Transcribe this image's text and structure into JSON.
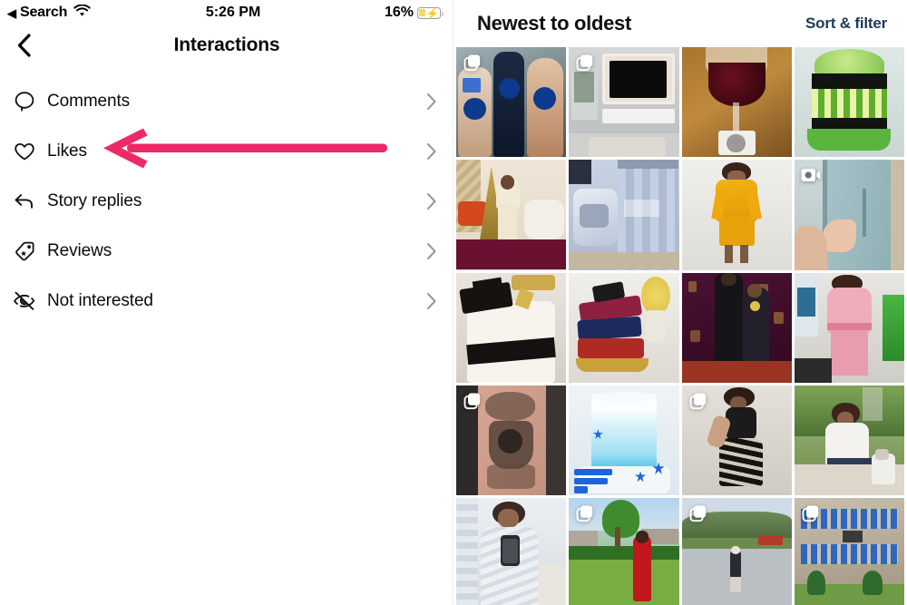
{
  "status_bar": {
    "back_label": "Search",
    "back_arrow": "left-triangle-icon",
    "wifi": "wifi-icon",
    "time": "5:26 PM",
    "battery_percent": "16%",
    "battery_icon": "battery-charging-icon"
  },
  "nav": {
    "back_icon": "chevron-left-icon",
    "title": "Interactions"
  },
  "menu": {
    "items": [
      {
        "label": "Comments",
        "icon": "comment-bubble-icon",
        "chevron": "chevron-right-icon"
      },
      {
        "label": "Likes",
        "icon": "heart-icon",
        "chevron": "chevron-right-icon"
      },
      {
        "label": "Story replies",
        "icon": "reply-arrow-icon",
        "chevron": "chevron-right-icon"
      },
      {
        "label": "Reviews",
        "icon": "tag-icon",
        "chevron": "chevron-right-icon"
      },
      {
        "label": "Not interested",
        "icon": "eye-slash-icon",
        "chevron": "chevron-right-icon"
      }
    ]
  },
  "annotation": {
    "type": "arrow-left",
    "points_to": "Likes",
    "color": "#ED2A67"
  },
  "right_panel": {
    "header": {
      "sort_label": "Newest to oldest",
      "filter_label": "Sort & filter",
      "filter_color": "#1C3B57"
    },
    "grid": {
      "columns": 4,
      "tiles": [
        {
          "id": "r1c1",
          "caption": "NIVEA body lotion bottles",
          "badge": "carousel-icon",
          "badge_side": "left"
        },
        {
          "id": "r1c2",
          "caption": "Living room with TV wall",
          "badge": "carousel-icon",
          "badge_side": "left"
        },
        {
          "id": "r1c3",
          "caption": "Glass of red wine on table",
          "badge": null,
          "badge_side": null
        },
        {
          "id": "r1c4",
          "caption": "Green and black layer cake",
          "badge": null,
          "badge_side": null
        },
        {
          "id": "r2c1",
          "caption": "Woman by Christmas tree",
          "badge": null,
          "badge_side": null
        },
        {
          "id": "r2c2",
          "caption": "Bedding and curtain set",
          "badge": null,
          "badge_side": null
        },
        {
          "id": "r2c3",
          "caption": "Woman in yellow jumpsuit",
          "badge": null,
          "badge_side": null
        },
        {
          "id": "r2c4",
          "caption": "Hand opening blue cabinet",
          "badge": "video-icon",
          "badge_side": "left"
        },
        {
          "id": "r3c1",
          "caption": "Graduation cap cake",
          "badge": null,
          "badge_side": null
        },
        {
          "id": "r3c2",
          "caption": "Stacked books cake",
          "badge": null,
          "badge_side": null
        },
        {
          "id": "r3c3",
          "caption": "Couple on red carpet",
          "badge": null,
          "badge_side": null
        },
        {
          "id": "r3c4",
          "caption": "Woman in pink outfit",
          "badge": null,
          "badge_side": null
        },
        {
          "id": "r4c1",
          "caption": "Anime leg tattoo",
          "badge": "carousel-icon",
          "badge_side": "left"
        },
        {
          "id": "r4c2",
          "caption": "Blue ombre birthday cake",
          "badge": null,
          "badge_side": null
        },
        {
          "id": "r4c3",
          "caption": "Woman in black outfit",
          "badge": "carousel-icon",
          "badge_side": "left"
        },
        {
          "id": "r4c4",
          "caption": "Woman seated outdoors",
          "badge": null,
          "badge_side": null
        },
        {
          "id": "r5c1",
          "caption": "Mirror selfie with phone",
          "badge": null,
          "badge_side": null
        },
        {
          "id": "r5c2",
          "caption": "Woman in red on lawn",
          "badge": "carousel-icon",
          "badge_side": "left"
        },
        {
          "id": "r5c3",
          "caption": "Person walking near hills",
          "badge": "carousel-icon",
          "badge_side": "left"
        },
        {
          "id": "r5c4",
          "caption": "Stone building with windows",
          "badge": "carousel-icon",
          "badge_side": "left"
        }
      ]
    }
  }
}
